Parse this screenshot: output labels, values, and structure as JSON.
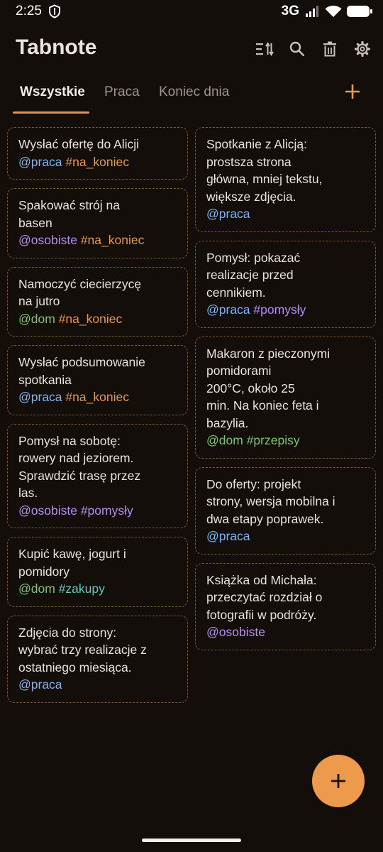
{
  "status_bar": {
    "time": "2:25",
    "network": "3G",
    "icons": [
      "shield-icon",
      "signal-icon",
      "wifi-icon",
      "battery-icon"
    ]
  },
  "app": {
    "title": "Tabnote"
  },
  "header_icons": [
    "sort-icon",
    "search-icon",
    "trash-icon",
    "settings-icon"
  ],
  "tabs": [
    {
      "label": "Wszystkie",
      "active": true
    },
    {
      "label": "Praca",
      "active": false
    },
    {
      "label": "Koniec dnia",
      "active": false
    }
  ],
  "colors": {
    "accent": "#ee9a4c",
    "background": "#140e0a",
    "border": "#7e5632",
    "tag_praca": "#7fb2f4",
    "tag_osobiste": "#b48ef2",
    "tag_dom": "#7cc56c",
    "tag_na_koniec": "#ea9448",
    "tag_pomysly": "#b48ef2",
    "tag_przepisy": "#7cc56c",
    "tag_zakupy": "#62c6be"
  },
  "notes_left": [
    {
      "text": "Wysłać ofertę do Alicji",
      "tags": [
        {
          "text": "@praca",
          "kind": "praca"
        },
        {
          "text": "#na_koniec",
          "kind": "na_koniec"
        }
      ]
    },
    {
      "text": "Spakować strój na\nbasen",
      "tags": [
        {
          "text": "@osobiste",
          "kind": "osobiste"
        },
        {
          "text": "#na_koniec",
          "kind": "na_koniec"
        }
      ]
    },
    {
      "text": "Namoczyć ciecierzycę\nna jutro",
      "tags": [
        {
          "text": "@dom",
          "kind": "dom"
        },
        {
          "text": "#na_koniec",
          "kind": "na_koniec"
        }
      ]
    },
    {
      "text": "Wysłać podsumowanie\nspotkania",
      "tags": [
        {
          "text": "@praca",
          "kind": "praca"
        },
        {
          "text": "#na_koniec",
          "kind": "na_koniec"
        }
      ]
    },
    {
      "text": "Pomysł na sobotę:\nrowery nad jeziorem.\nSprawdzić trasę przez\nlas.",
      "tags": [
        {
          "text": "@osobiste",
          "kind": "osobiste"
        },
        {
          "text": "#pomysły",
          "kind": "pomysly"
        }
      ]
    },
    {
      "text": "Kupić kawę, jogurt i\npomidory",
      "tags": [
        {
          "text": "@dom",
          "kind": "dom"
        },
        {
          "text": "#zakupy",
          "kind": "zakupy"
        }
      ]
    },
    {
      "text": "Zdjęcia do strony:\nwybrać trzy realizacje z\nostatniego miesiąca.",
      "tags": [
        {
          "text": "@praca",
          "kind": "praca"
        }
      ]
    }
  ],
  "notes_right": [
    {
      "text": "Spotkanie z Alicją:\nprostsza strona\ngłówna, mniej tekstu,\nwiększe zdjęcia.",
      "tags": [
        {
          "text": "@praca",
          "kind": "praca"
        }
      ]
    },
    {
      "text": "Pomysł: pokazać\nrealizacje przed\ncennikiem.",
      "tags": [
        {
          "text": "@praca",
          "kind": "praca"
        },
        {
          "text": "#pomysły",
          "kind": "pomysly"
        }
      ]
    },
    {
      "text": "Makaron z pieczonymi\npomidorami\n200°C, około 25\nmin. Na koniec feta i\nbazylia.",
      "tags": [
        {
          "text": "@dom",
          "kind": "dom"
        },
        {
          "text": "#przepisy",
          "kind": "przepisy"
        }
      ]
    },
    {
      "text": "Do oferty: projekt\nstrony, wersja mobilna i\ndwa etapy poprawek.",
      "tags": [
        {
          "text": "@praca",
          "kind": "praca"
        }
      ]
    },
    {
      "text": "Książka od Michała:\nprzeczytać rozdział o\nfotografii w podróży.",
      "tags": [
        {
          "text": "@osobiste",
          "kind": "osobiste"
        }
      ]
    }
  ]
}
